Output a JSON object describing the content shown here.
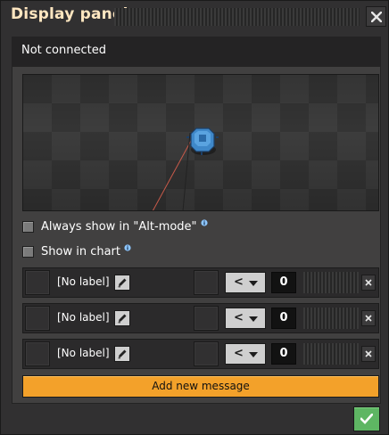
{
  "window": {
    "title": "Display panel",
    "close_icon": "close-icon"
  },
  "status": {
    "text": "Not connected"
  },
  "options": [
    {
      "label": "Always show in \"Alt-mode\"",
      "checked": false
    },
    {
      "label": "Show in chart",
      "checked": false
    }
  ],
  "messages": [
    {
      "label": "[No label]",
      "comparator": "<",
      "value": "0"
    },
    {
      "label": "[No label]",
      "comparator": "<",
      "value": "0"
    },
    {
      "label": "[No label]",
      "comparator": "<",
      "value": "0"
    }
  ],
  "actions": {
    "add_message": "Add new message",
    "confirm_icon": "checkmark-icon"
  },
  "colors": {
    "window_bg": "#313031",
    "title_text": "#ffe6c0",
    "accent_orange": "#f3a12a",
    "confirm_green": "#5eb663",
    "info_blue": "#8ec7ff"
  }
}
